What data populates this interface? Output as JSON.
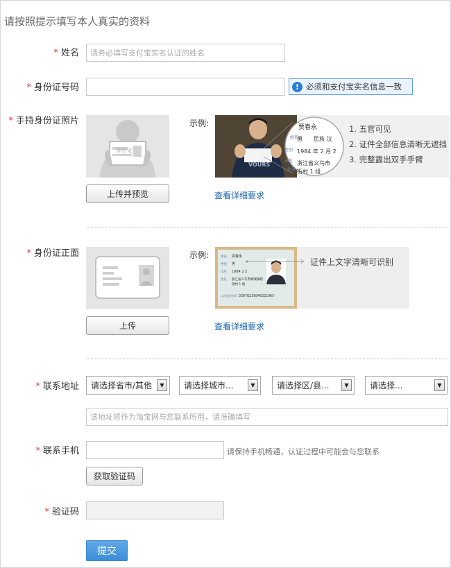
{
  "page": {
    "title": "请按照提示填写本人真实的资料"
  },
  "colors": {
    "required": "#e4393c",
    "link": "#1a62a8",
    "primary": "#3b8dd9",
    "hint_border": "#6aa0d8"
  },
  "form": {
    "required_mark": "*",
    "name": {
      "label": "姓名",
      "placeholder": "请务必填写支付宝实名认证的姓名"
    },
    "id_number": {
      "label": "身份证号码",
      "hint": "必须和支付宝实名信息一致",
      "hint_icon": "info-icon"
    },
    "handheld_photo": {
      "label": "手持身份证照片",
      "example_label": "示例:",
      "upload_button": "上传并预览",
      "detail_link": "查看详细要求",
      "card_text": "身份证",
      "example_card": {
        "name": "贾春永",
        "gender": "男",
        "ethnicity": "民族 汉",
        "birth": "1984 年 2 月 2",
        "address_1": "浙江省义乌市",
        "address_2": "街村 1 组",
        "side_labels": [
          "姓名",
          "性别",
          "出生",
          "住址"
        ],
        "shirt_text": "VOURS"
      },
      "steps": [
        "1. 五官可见",
        "2. 证件全部信息清晰无遮挡",
        "3. 完整露出双手手臂"
      ]
    },
    "id_front": {
      "label": "身份证正面",
      "example_label": "示例:",
      "upload_button": "上传",
      "detail_link": "查看详细要求",
      "example_note": "证件上文字清晰可识别",
      "example_card": {
        "name": "贾春永",
        "gender": "男",
        "birth": "1984 2 2",
        "address": "浙江省义乌市稠城镇塔",
        "address_2": "街村 1 组",
        "id_label": "公民身份号码",
        "id_number": "3307821984022106X"
      }
    },
    "address": {
      "label": "联系地址",
      "province": "请选择省市/其他",
      "city": "请选择城市...",
      "district": "请选择区/县...",
      "street": "请选择...",
      "detail_placeholder": "该地址将作为淘宝网与您联系所用，请准确填写"
    },
    "phone": {
      "label": "联系手机",
      "hint": "请保持手机畅通，认证过程中可能会与您联系",
      "get_code_button": "获取验证码"
    },
    "verify_code": {
      "label": "验证码"
    },
    "submit_button": "提交"
  }
}
